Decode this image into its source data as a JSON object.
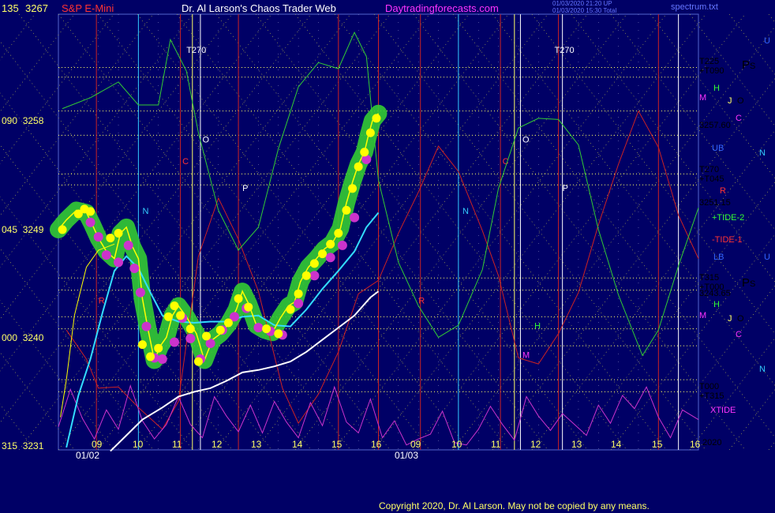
{
  "header": {
    "symbol": "S&P E-Mini",
    "title": "Dr. Al Larson's Chaos Trader Web",
    "site": "Daytradingforecasts.com",
    "stamp1": "01/03/2020 21:20 UP",
    "stamp2": "01/03/2020 15:30 Total",
    "file": "spectrum.txt"
  },
  "copyright": "Copyright 2020, Dr. Al Larson. May not be copied by any means.",
  "colors": {
    "background": "#000066",
    "grid_yellow": "#ffff66",
    "price_yellow": "#ffff00",
    "cyan": "#33ddff",
    "green_glow": "#33cc33",
    "magenta": "#cc33cc",
    "white": "#ffffff",
    "red": "#cc2222",
    "green_line": "#33cc33"
  },
  "chart_data": {
    "type": "line",
    "title": "S&P E-Mini",
    "ylim": [
      3231,
      3267
    ],
    "y_ticks": [
      {
        "value": 3267,
        "left": "135",
        "right": "3267"
      },
      {
        "value": 3258,
        "left": "090",
        "right": "3258"
      },
      {
        "value": 3249,
        "left": "045",
        "right": "3249"
      },
      {
        "value": 3240,
        "left": "000",
        "right": "3240"
      },
      {
        "value": 3231,
        "left": "315",
        "right": "3231"
      }
    ],
    "x_ticks": [
      "09",
      "10",
      "11",
      "12",
      "13",
      "14",
      "15",
      "16",
      "09",
      "10",
      "11",
      "12",
      "13",
      "14",
      "15",
      "16"
    ],
    "date_labels": [
      "01/02",
      "01/03"
    ],
    "x_range": [
      0,
      16
    ],
    "right_labels": [
      {
        "text": "T225",
        "value": 3263.4,
        "color": "#ffffff"
      },
      {
        "text": "+T090",
        "value": 3262.4,
        "color": "#ffffff"
      },
      {
        "text": "3257.60",
        "value": 3257.6,
        "color": "#ffffff"
      },
      {
        "text": "T270",
        "value": 3254.2,
        "color": "#ffffff"
      },
      {
        "text": "+T045",
        "value": 3253.2,
        "color": "#ffffff"
      },
      {
        "text": "3251.15",
        "value": 3251.15,
        "color": "#ffffff"
      },
      {
        "text": "+TIDE-2",
        "value": 3249.8,
        "color": "#33ff33"
      },
      {
        "text": "-TIDE-1",
        "value": 3247.5,
        "color": "#ff3333"
      },
      {
        "text": "T315",
        "value": 3244.9,
        "color": "#ffffff"
      },
      {
        "text": "+T000",
        "value": 3243.9,
        "color": "#ffffff"
      },
      {
        "text": "3243.65",
        "value": 3243.65,
        "color": "#ffffff"
      },
      {
        "text": "T000",
        "value": 3236.4,
        "color": "#ffffff"
      },
      {
        "text": "+T315",
        "value": 3235.4,
        "color": "#ffffff"
      },
      {
        "text": "XTIDE",
        "value": 3234.2,
        "color": "#ff33ff"
      },
      {
        "text": "2020",
        "value": 3231.3,
        "color": "#ffffff"
      }
    ],
    "marker_labels": [
      {
        "text": "S&P",
        "color": "#ffffff"
      },
      {
        "text": "U",
        "color": "#3366ff"
      },
      {
        "text": "P",
        "color": "#ffffff"
      },
      {
        "text": "S",
        "color": "#ffffff"
      },
      {
        "text": "H",
        "color": "#33ff33"
      },
      {
        "text": "M",
        "color": "#ff33ff"
      },
      {
        "text": "J",
        "color": "#ffff66"
      },
      {
        "text": "O",
        "color": "#ffffff"
      },
      {
        "text": "C",
        "color": "#ff33ff"
      },
      {
        "text": "UB",
        "color": "#3366ff"
      },
      {
        "text": "N",
        "color": "#33ccff"
      },
      {
        "text": "R",
        "color": "#ff3333"
      },
      {
        "text": "LB",
        "color": "#3366ff"
      }
    ],
    "in_chart_labels": [
      {
        "text": "T270",
        "x": 3.2,
        "y": 3263.8,
        "color": "#ffffff"
      },
      {
        "text": "T270",
        "x": 12.4,
        "y": 3263.8,
        "color": "#ffffff"
      },
      {
        "text": "O",
        "x": 3.6,
        "y": 3256.4,
        "color": "#ffffff"
      },
      {
        "text": "O",
        "x": 11.6,
        "y": 3256.4,
        "color": "#ffffff"
      },
      {
        "text": "C",
        "x": 3.1,
        "y": 3254.6,
        "color": "#ff3333"
      },
      {
        "text": "C",
        "x": 11.1,
        "y": 3254.6,
        "color": "#ff3333"
      },
      {
        "text": "P",
        "x": 4.6,
        "y": 3252.4,
        "color": "#ffffff"
      },
      {
        "text": "P",
        "x": 12.6,
        "y": 3252.4,
        "color": "#ffffff"
      },
      {
        "text": "N",
        "x": 2.1,
        "y": 3250.5,
        "color": "#33ccff"
      },
      {
        "text": "N",
        "x": 10.1,
        "y": 3250.5,
        "color": "#33ccff"
      },
      {
        "text": "R",
        "x": 1.0,
        "y": 3243.1,
        "color": "#ff3333"
      },
      {
        "text": "R",
        "x": 9.0,
        "y": 3243.1,
        "color": "#ff3333"
      },
      {
        "text": "H",
        "x": 11.9,
        "y": 3241.0,
        "color": "#33ff33"
      },
      {
        "text": "M",
        "x": 11.6,
        "y": 3238.6,
        "color": "#ff33ff"
      }
    ],
    "grid_lines_h": [
      3262.6,
      3261.8,
      3259.0,
      3257.0,
      3253.8,
      3252.9,
      3245.2,
      3244.2,
      3242.0,
      3241.0,
      3239.6,
      3236.8,
      3235.8
    ],
    "vertical_lines": [
      {
        "x": 0.95,
        "color": "#cc2222"
      },
      {
        "x": 2.0,
        "color": "#33ccff"
      },
      {
        "x": 3.05,
        "color": "#cc2222"
      },
      {
        "x": 3.35,
        "color": "#ffff66"
      },
      {
        "x": 3.55,
        "color": "#ffffff"
      },
      {
        "x": 4.5,
        "color": "#cc2222"
      },
      {
        "x": 7.0,
        "color": "#cc2222"
      },
      {
        "x": 8.0,
        "color": "#cc2222"
      },
      {
        "x": 9.05,
        "color": "#cc2222"
      },
      {
        "x": 10.0,
        "color": "#33ccff"
      },
      {
        "x": 11.05,
        "color": "#cc2222"
      },
      {
        "x": 11.4,
        "color": "#ffff66"
      },
      {
        "x": 11.55,
        "color": "#ffffff"
      },
      {
        "x": 12.5,
        "color": "#cc2222"
      },
      {
        "x": 12.6,
        "color": "#ffffff"
      },
      {
        "x": 15.0,
        "color": "#cc2222"
      },
      {
        "x": 15.5,
        "color": "#ffffff"
      }
    ],
    "series": [
      {
        "name": "Price",
        "color": "#ffff00",
        "x": [
          0.0,
          0.2,
          0.45,
          0.7,
          0.85,
          1.0,
          1.2,
          1.4,
          1.55,
          1.7,
          1.85,
          2.0,
          2.1,
          2.25,
          2.4,
          2.55,
          2.7,
          2.85,
          3.0,
          3.2,
          3.45,
          3.65,
          3.85,
          4.05,
          4.25,
          4.45,
          4.6,
          4.75,
          4.95,
          5.15,
          5.35,
          5.55,
          5.75,
          5.9,
          6.05,
          6.25,
          6.45,
          6.65,
          6.85,
          7.05,
          7.2,
          7.35,
          7.5,
          7.65,
          7.75,
          7.85,
          8.0
        ],
        "y": [
          3249.2,
          3250.0,
          3250.8,
          3250.6,
          3249.6,
          3248.5,
          3247.4,
          3246.8,
          3248.9,
          3249.4,
          3247.8,
          3246.8,
          3243.5,
          3240.8,
          3238.4,
          3239.6,
          3240.3,
          3242.1,
          3242.9,
          3242.0,
          3240.6,
          3238.4,
          3240.1,
          3240.6,
          3241.4,
          3242.6,
          3244.1,
          3243.1,
          3241.3,
          3240.9,
          3240.7,
          3241.9,
          3242.9,
          3243.2,
          3244.9,
          3246.1,
          3246.8,
          3247.6,
          3248.1,
          3249.3,
          3251.4,
          3253.1,
          3254.6,
          3255.6,
          3257.0,
          3258.2,
          3258.8
        ]
      },
      {
        "name": "Cyan average",
        "color": "#33ddff",
        "x": [
          0.2,
          0.5,
          0.8,
          1.1,
          1.4,
          1.7,
          2.0,
          2.3,
          2.6,
          3.0,
          3.4,
          3.8,
          4.2,
          4.6,
          5.0,
          5.4,
          5.8,
          6.2,
          6.6,
          7.0,
          7.4,
          7.7,
          8.0
        ],
        "y": [
          3231.2,
          3235.5,
          3238.5,
          3242.3,
          3245.8,
          3247.0,
          3246.0,
          3244.0,
          3242.1,
          3241.6,
          3241.5,
          3241.6,
          3241.6,
          3242.0,
          3242.1,
          3241.3,
          3241.2,
          3242.6,
          3244.3,
          3245.8,
          3247.4,
          3249.4,
          3250.6
        ]
      },
      {
        "name": "White average",
        "color": "#ffffff",
        "x": [
          1.3,
          1.7,
          2.1,
          2.6,
          3.0,
          3.4,
          3.8,
          4.2,
          4.6,
          5.0,
          5.4,
          5.8,
          6.2,
          6.6,
          7.0,
          7.4,
          7.8,
          8.0
        ],
        "y": [
          3230.9,
          3232.2,
          3233.5,
          3234.5,
          3235.4,
          3235.8,
          3236.1,
          3236.7,
          3237.4,
          3237.6,
          3237.9,
          3238.3,
          3239.1,
          3240.1,
          3241.1,
          3242.1,
          3243.6,
          3244.1
        ]
      },
      {
        "name": "Yellow average",
        "color": "#ffff00",
        "x": [
          0.05,
          0.2,
          0.4,
          0.7,
          1.0,
          1.4
        ],
        "y": [
          3233.7,
          3236.8,
          3242.1,
          3246.1,
          3247.5,
          3248.0
        ]
      },
      {
        "name": "Green tide",
        "color": "#33cc33",
        "x": [
          0.1,
          0.8,
          1.5,
          2.0,
          2.5,
          2.8,
          3.2,
          3.5,
          4.0,
          4.5,
          5.0,
          5.5,
          6.0,
          6.5,
          7.0,
          7.4,
          7.7,
          8.0,
          8.5,
          9.0,
          9.5,
          10.0,
          10.6,
          11.0,
          11.5,
          12.0,
          12.5,
          13.0,
          13.5,
          14.0,
          14.6,
          15.0,
          15.5,
          16.0
        ],
        "y": [
          3259.2,
          3260.1,
          3261.4,
          3259.5,
          3259.5,
          3264.9,
          3262.3,
          3257.2,
          3250.8,
          3247.5,
          3249.4,
          3255.9,
          3261.0,
          3263.0,
          3262.5,
          3265.5,
          3263.5,
          3253.3,
          3246.5,
          3242.9,
          3240.3,
          3241.3,
          3245.9,
          3252.6,
          3257.6,
          3258.4,
          3258.3,
          3256.2,
          3249.2,
          3243.8,
          3238.8,
          3240.9,
          3246.2,
          3251.0
        ]
      },
      {
        "name": "Red tide",
        "color": "#cc2222",
        "x": [
          0.2,
          0.7,
          1.0,
          1.5,
          2.0,
          2.6,
          3.0,
          3.5,
          4.0,
          4.5,
          5.0,
          5.3,
          5.6,
          6.0,
          6.5,
          7.0,
          7.5,
          8.0,
          8.5,
          9.0,
          9.5,
          10.0,
          10.6,
          11.0,
          11.5,
          12.0,
          12.5,
          13.0,
          13.5,
          14.0,
          14.5,
          15.0,
          15.5,
          16.0
        ],
        "y": [
          3240.9,
          3238.5,
          3236.1,
          3236.2,
          3234.5,
          3232.7,
          3235.0,
          3247.0,
          3251.8,
          3248.4,
          3244.1,
          3240.1,
          3236.1,
          3233.2,
          3235.6,
          3239.1,
          3243.9,
          3245.0,
          3248.9,
          3252.3,
          3256.1,
          3254.0,
          3249.1,
          3245.4,
          3238.6,
          3238.1,
          3240.6,
          3244.0,
          3249.6,
          3254.6,
          3259.0,
          3256.0,
          3250.4,
          3246.8
        ]
      },
      {
        "name": "XTIDE",
        "color": "#cc33cc",
        "x": [
          0.0,
          0.3,
          0.6,
          0.9,
          1.2,
          1.5,
          1.8,
          2.1,
          2.4,
          2.7,
          3.0,
          3.3,
          3.6,
          3.9,
          4.2,
          4.5,
          4.8,
          5.1,
          5.4,
          5.7,
          6.0,
          6.3,
          6.6,
          6.9,
          7.2,
          7.5,
          7.8,
          8.1,
          8.4,
          8.7,
          9.0,
          9.3,
          9.6,
          9.9,
          10.2,
          10.5,
          10.8,
          11.1,
          11.4,
          11.7,
          12.0,
          12.3,
          12.6,
          12.9,
          13.2,
          13.5,
          13.8,
          14.1,
          14.4,
          14.7,
          15.0,
          15.3,
          15.6,
          16.0
        ],
        "y": [
          3232.9,
          3236.0,
          3233.6,
          3231.9,
          3234.3,
          3232.7,
          3236.3,
          3233.4,
          3231.9,
          3233.1,
          3235.4,
          3233.1,
          3232.0,
          3235.4,
          3233.8,
          3232.5,
          3234.7,
          3232.4,
          3235.0,
          3233.3,
          3232.0,
          3234.9,
          3233.0,
          3236.2,
          3233.3,
          3232.4,
          3235.2,
          3232.0,
          3233.4,
          3231.4,
          3231.9,
          3232.3,
          3234.2,
          3231.6,
          3231.4,
          3232.7,
          3234.6,
          3233.1,
          3231.8,
          3235.4,
          3233.8,
          3232.6,
          3234.0,
          3233.1,
          3232.2,
          3234.7,
          3233.2,
          3235.5,
          3234.4,
          3236.2,
          3233.7,
          3232.0,
          3234.3,
          3233.5
        ]
      }
    ],
    "dots": {
      "yellow_x": [
        0.1,
        0.5,
        0.65,
        0.8,
        1.3,
        1.5,
        2.1,
        2.3,
        2.5,
        2.75,
        2.9,
        3.05,
        3.3,
        3.5,
        3.7,
        4.05,
        4.25,
        4.5,
        4.75,
        5.2,
        5.5,
        5.8,
        6.0,
        6.2,
        6.4,
        6.6,
        6.8,
        7.0,
        7.2,
        7.35,
        7.5,
        7.65,
        7.8,
        7.95
      ],
      "yellow_y": [
        3249.2,
        3250.5,
        3250.9,
        3250.7,
        3248.5,
        3248.9,
        3239.7,
        3238.7,
        3239.4,
        3242.0,
        3242.9,
        3242.1,
        3241.0,
        3238.3,
        3240.4,
        3240.9,
        3241.5,
        3243.5,
        3242.8,
        3241.0,
        3240.6,
        3242.6,
        3243.9,
        3245.4,
        3246.4,
        3247.2,
        3248.0,
        3248.9,
        3250.8,
        3252.6,
        3254.4,
        3255.6,
        3257.2,
        3258.4
      ],
      "magenta_x": [
        0.8,
        1.0,
        1.2,
        1.5,
        1.75,
        1.9,
        2.05,
        2.2,
        2.4,
        2.6,
        2.9,
        3.1,
        3.3,
        3.55,
        3.8,
        4.1,
        4.4,
        4.7,
        5.0,
        5.3,
        5.6,
        6.0,
        6.4,
        6.8,
        7.1,
        7.4,
        7.7
      ],
      "magenta_y": [
        3249.8,
        3248.6,
        3247.1,
        3246.5,
        3247.9,
        3246.0,
        3244.0,
        3241.2,
        3238.6,
        3238.5,
        3239.9,
        3241.9,
        3240.2,
        3238.5,
        3239.8,
        3240.9,
        3242.0,
        3242.7,
        3241.1,
        3240.8,
        3240.5,
        3243.1,
        3245.4,
        3246.9,
        3247.9,
        3250.2,
        3255.0
      ]
    }
  }
}
